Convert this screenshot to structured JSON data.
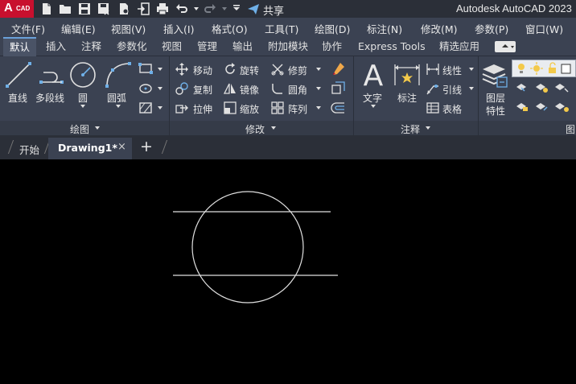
{
  "app": {
    "logo_big": "A",
    "logo_small": "CAD",
    "title": "Autodesk AutoCAD 2023",
    "share_label": "共享"
  },
  "quick_access": [
    {
      "icon": "new-file-icon"
    },
    {
      "icon": "open-folder-icon"
    },
    {
      "icon": "save-icon"
    },
    {
      "icon": "save-as-icon"
    },
    {
      "icon": "plot-web-icon"
    },
    {
      "icon": "import-icon"
    },
    {
      "icon": "export-icon"
    },
    {
      "icon": "print-icon"
    },
    {
      "icon": "undo-icon"
    },
    {
      "icon": "redo-icon"
    },
    {
      "icon": "customize-icon"
    },
    {
      "icon": "share-icon"
    }
  ],
  "menu": [
    "文件(F)",
    "编辑(E)",
    "视图(V)",
    "插入(I)",
    "格式(O)",
    "工具(T)",
    "绘图(D)",
    "标注(N)",
    "修改(M)",
    "参数(P)",
    "窗口(W)"
  ],
  "ribbon_tabs": [
    "默认",
    "插入",
    "注释",
    "参数化",
    "视图",
    "管理",
    "输出",
    "附加模块",
    "协作",
    "Express Tools",
    "精选应用"
  ],
  "ribbon": {
    "draw": {
      "title": "绘图",
      "line": "直线",
      "polyline": "多段线",
      "circle": "圆",
      "arc": "圆弧"
    },
    "modify": {
      "title": "修改",
      "move": "移动",
      "rotate": "旋转",
      "trim": "修剪",
      "copy": "复制",
      "mirror": "镜像",
      "fillet": "圆角",
      "stretch": "拉伸",
      "scale": "缩放",
      "array": "阵列"
    },
    "annotation": {
      "title": "注释",
      "text": "文字",
      "dimension": "标注",
      "linear": "线性",
      "leader": "引线",
      "table": "表格"
    },
    "layers": {
      "title": "图",
      "properties_line1": "图层",
      "properties_line2": "特性"
    }
  },
  "doc_tabs": {
    "start": "开始",
    "drawing": "Drawing1*",
    "close": "×",
    "add": "+"
  },
  "colors": {
    "accent": "#c8102e",
    "ribbon_bg": "#3b4252",
    "canvas_bg": "#000000",
    "geometry": "#ffffff"
  }
}
